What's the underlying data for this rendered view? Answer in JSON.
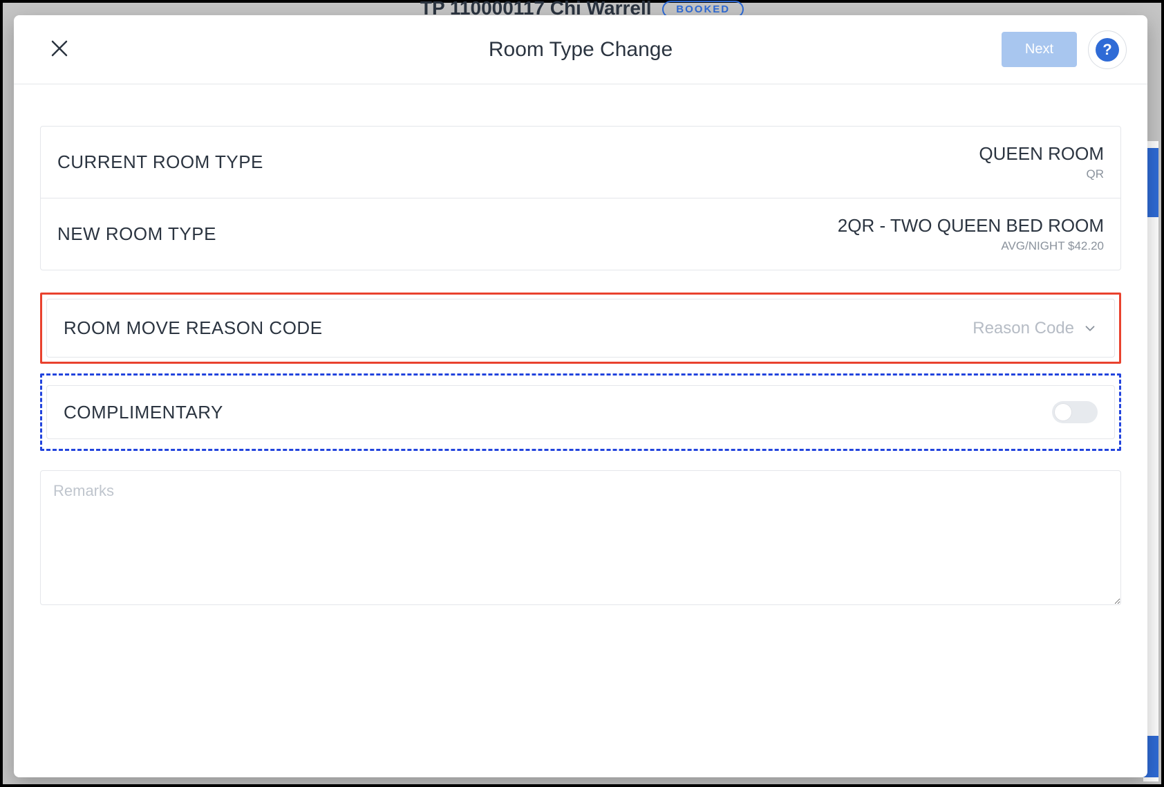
{
  "background": {
    "header_text": "TP 110000117 Chi Warrell",
    "badge": "BOOKED"
  },
  "dialog": {
    "title": "Room Type Change",
    "close_icon": "close",
    "next_label": "Next",
    "help_icon": "?"
  },
  "rows": {
    "current": {
      "label": "CURRENT ROOM TYPE",
      "value": "QUEEN ROOM",
      "sub": "QR"
    },
    "new": {
      "label": "NEW ROOM TYPE",
      "value": "2QR - TWO QUEEN BED ROOM",
      "sub": "AVG/NIGHT $42.20"
    },
    "reason": {
      "label": "ROOM MOVE REASON CODE",
      "placeholder": "Reason Code"
    },
    "complimentary": {
      "label": "COMPLIMENTARY",
      "enabled": false
    }
  },
  "remarks": {
    "placeholder": "Remarks",
    "value": ""
  },
  "annotations": {
    "reason_highlight_color": "#e9422e",
    "complimentary_highlight_color": "#2244dd"
  }
}
